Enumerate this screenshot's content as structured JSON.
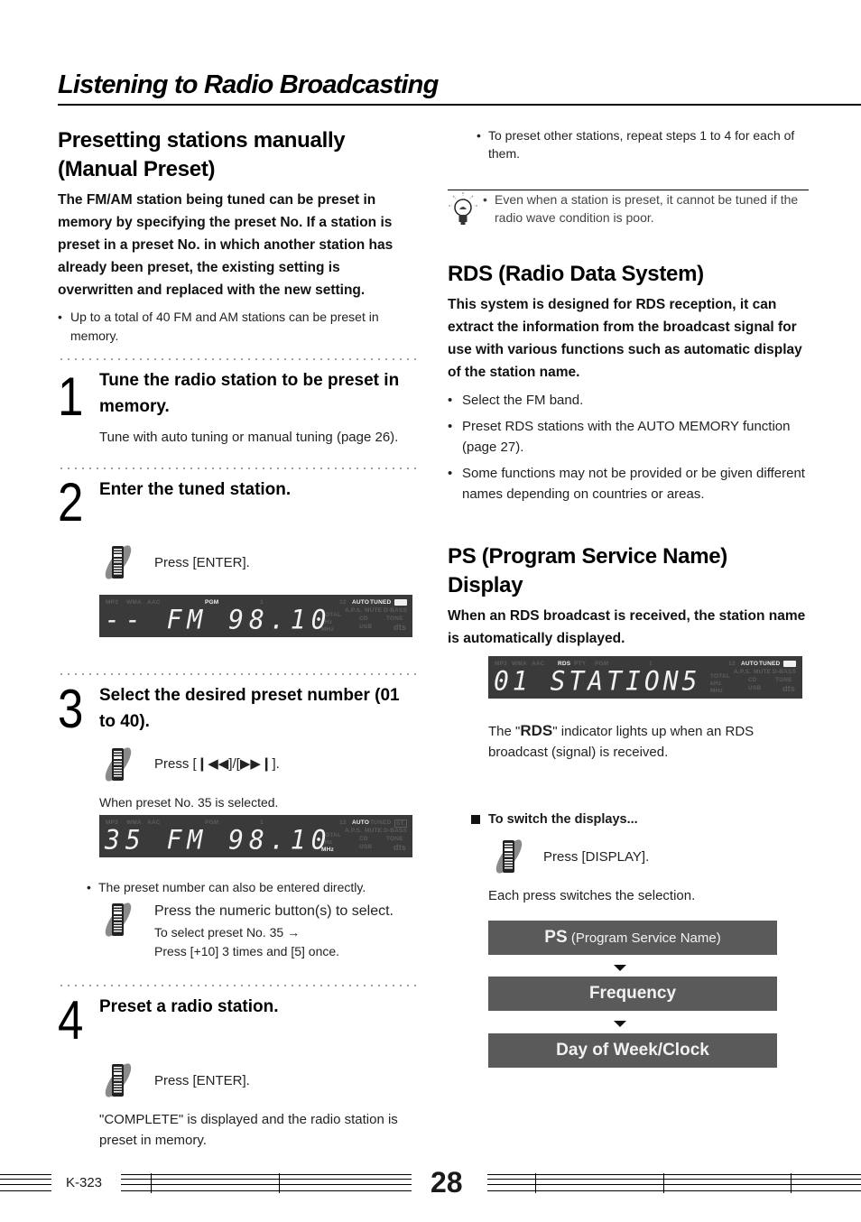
{
  "page": {
    "title": "Listening to Radio Broadcasting",
    "model": "K-323",
    "number": "28"
  },
  "left": {
    "heading_line1": "Presetting stations manually",
    "heading_line2": "(Manual Preset)",
    "lead": "The FM/AM station being tuned can be preset in memory by specifying the preset No. If a station is preset in a preset No. in which another station has already been preset, the existing setting is overwritten and replaced with the new setting.",
    "note": "Up to a total of 40 FM and AM stations can be preset in memory.",
    "steps": [
      {
        "number": "1",
        "title": "Tune the radio station to be preset in memory.",
        "body": "Tune with auto tuning or manual tuning (page 26)."
      },
      {
        "number": "2",
        "title": "Enter the tuned station.",
        "action": "Press [ENTER].",
        "display": {
          "main": "-- FM 98.10",
          "indicators_on": [
            "PGM",
            "AUTO",
            "TUNED",
            "ST."
          ]
        }
      },
      {
        "number": "3",
        "title": "Select the desired preset number (01 to 40).",
        "action": "Press [❙◀◀]/[▶▶❙].",
        "caption": "When preset No. 35 is selected.",
        "display": {
          "main": "35 FM 98.10",
          "indicators_on": [
            "AUTO",
            "MHz"
          ]
        },
        "note": "The preset number can also be entered directly.",
        "alt_action": "Press the numeric button(s) to select.",
        "alt_detail_1": "To select preset No. 35 →",
        "alt_detail_2": "Press [+10] 3 times and [5] once."
      },
      {
        "number": "4",
        "title": "Preset a radio station.",
        "action": "Press [ENTER].",
        "result": "\"COMPLETE\" is displayed and the radio station is preset in memory."
      }
    ]
  },
  "right": {
    "repeat_note": "To preset other stations, repeat steps 1 to 4 for each of them.",
    "tip": "Even when a station is preset, it cannot be tuned if the radio wave condition is poor.",
    "rds": {
      "heading": "RDS (Radio Data System)",
      "lead": "This system is designed for RDS reception, it can extract the information from the broadcast signal for use with various functions such as automatic display of the station name.",
      "bullets": [
        "Select the FM band.",
        "Preset RDS stations with the AUTO MEMORY function (page 27).",
        "Some functions may not be provided or be given different names depending on countries or areas."
      ]
    },
    "ps": {
      "heading_line1": "PS (Program Service Name)",
      "heading_line2": "Display",
      "lead": "When an RDS broadcast is received, the station name is automatically displayed.",
      "display": {
        "main": "01 STATION5",
        "indicators_on": [
          "RDS",
          "AUTO",
          "TUNED",
          "ST."
        ]
      },
      "rds_note_pre": "The \"",
      "rds_note_badge": "RDS",
      "rds_note_post": "\" indicator lights up when an RDS broadcast (signal) is received.",
      "switch_heading": "To switch the displays...",
      "switch_action": "Press [DISPLAY].",
      "switch_body": "Each press switches the selection.",
      "flow": [
        {
          "bold": "PS",
          "rest": " (Program Service Name)"
        },
        {
          "bold": "Frequency",
          "rest": ""
        },
        {
          "bold": "Day of Week/Clock",
          "rest": ""
        }
      ]
    }
  },
  "lcd_labels": {
    "mp3": "MP3",
    "wma": "WMA",
    "aac": "AAC",
    "rds": "RDS",
    "pty": "PTY",
    "pgm": "PGM",
    "one": "1",
    "twelve": "12",
    "auto": "AUTO",
    "tuned": "TUNED",
    "st": "ST.",
    "aps": "A.P.S.",
    "mute": "MUTE",
    "dbass": "D-BASS",
    "total": "TOTAL",
    "khz": "kHz",
    "mhz": "MHz",
    "cd": "CD",
    "usb": "USB",
    "tone": "TONE",
    "dts": "dts"
  }
}
